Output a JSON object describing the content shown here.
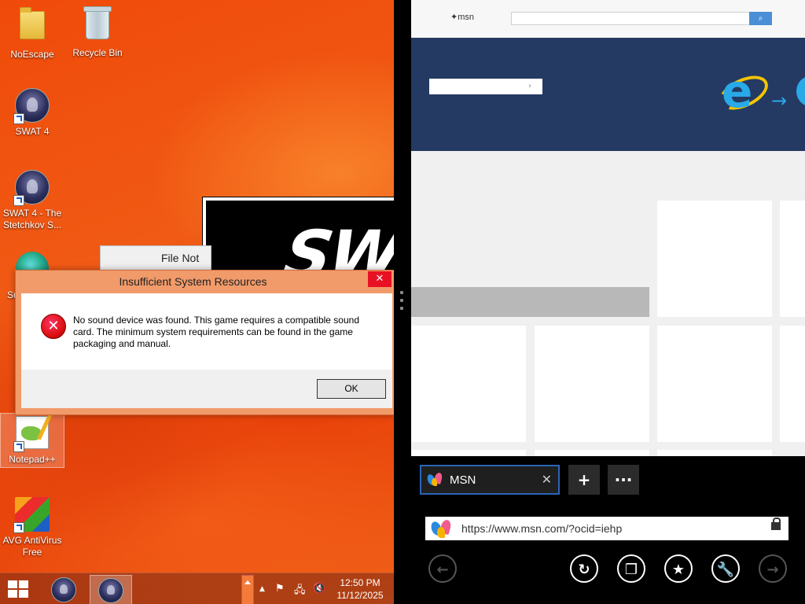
{
  "desktop": {
    "icons": [
      {
        "label": "NoEscape"
      },
      {
        "label": "Recycle Bin"
      },
      {
        "label": "SWAT 4"
      },
      {
        "label": "SWAT 4 - The Stetchkov S..."
      },
      {
        "label": "Su"
      },
      {
        "label": "Notepad++"
      },
      {
        "label": "AVG AntiVirus Free"
      }
    ],
    "background_window": {
      "logo_text": "SWA",
      "file_not_text": "File Not"
    }
  },
  "dialog": {
    "title": "Insufficient System Resources",
    "close_label": "✕",
    "message": "No sound device was found.  This game requires a compatible sound card. The minimum system requirements can be found in the game packaging and manual.",
    "ok_label": "OK",
    "icon": "error-icon"
  },
  "taskbar": {
    "clock_time": "12:50 PM",
    "clock_date": "11/12/2025",
    "tray_icons": [
      "chevron-up-icon",
      "flag-icon",
      "network-icon",
      "speaker-muted-icon"
    ]
  },
  "browser": {
    "page": {
      "logo_text": "msn",
      "search_button": "⌕",
      "banner_button_label": "›"
    },
    "tab": {
      "title": "MSN",
      "close_label": "✕"
    },
    "new_tab_label": "+",
    "more_label": "···",
    "address": "https://www.msn.com/?ocid=iehp",
    "nav": [
      "back-icon",
      "refresh-icon",
      "tabs-icon",
      "favorites-icon",
      "tools-icon",
      "forward-icon"
    ]
  },
  "colors": {
    "wallpaper": "#f04a0a",
    "dialog_frame": "#f19a6a",
    "close_red": "#e81123",
    "tab_border": "#2c64b8",
    "banner": "#243a63"
  }
}
